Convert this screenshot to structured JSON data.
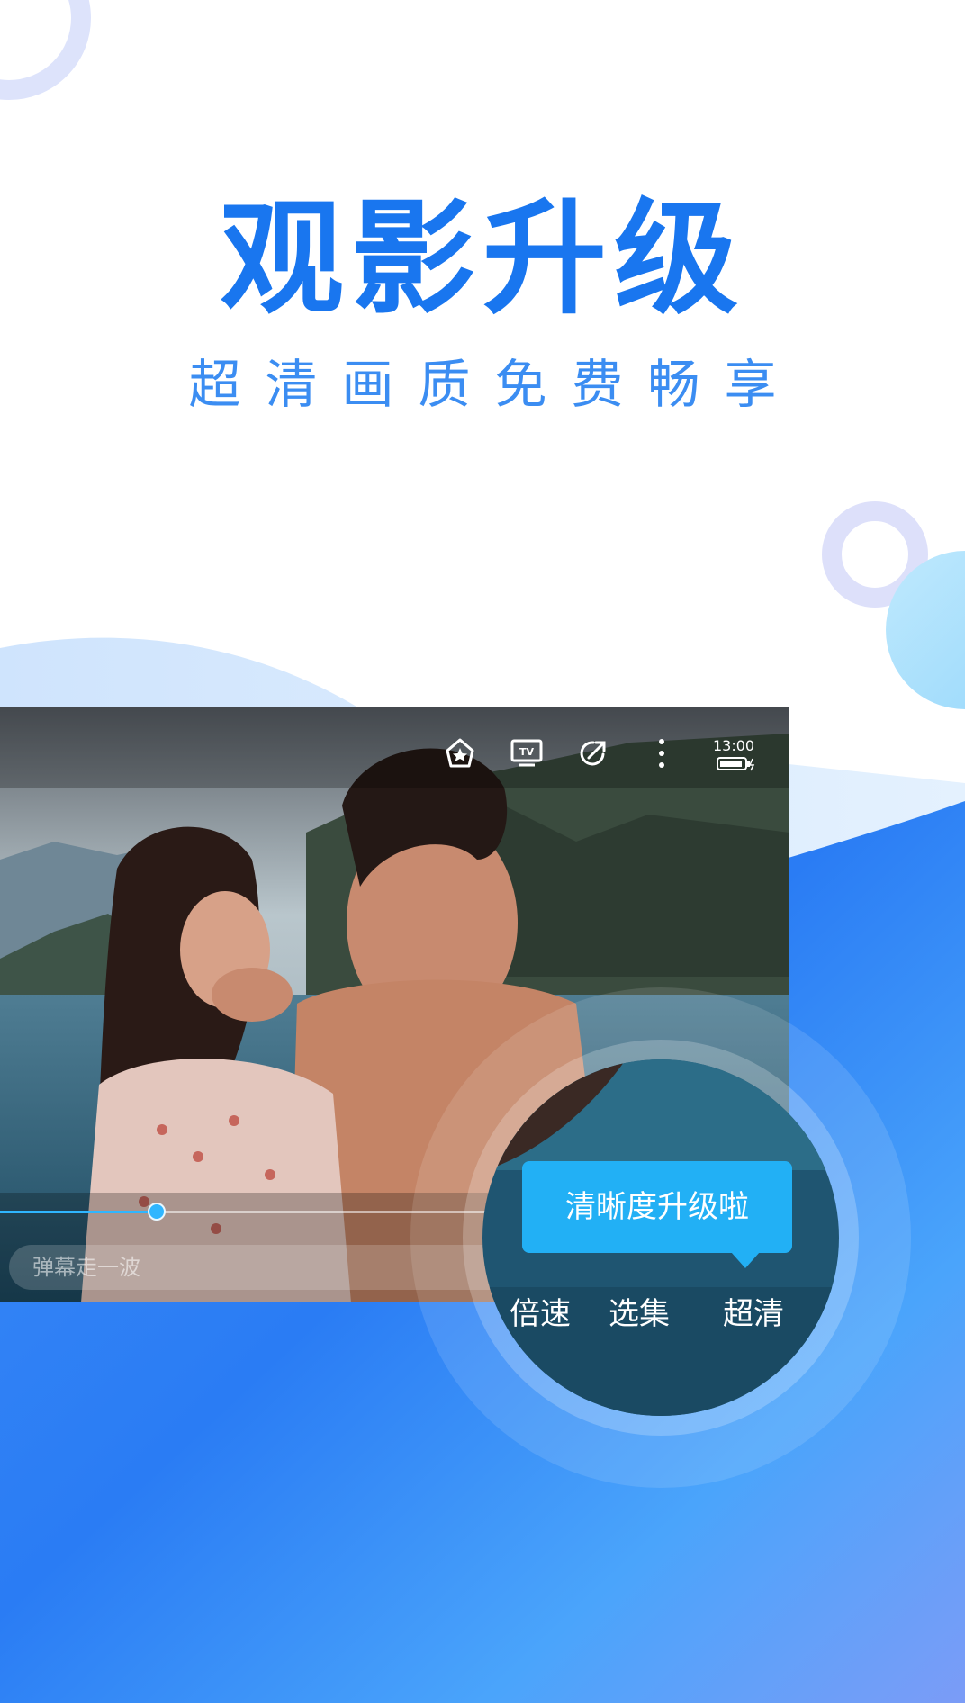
{
  "headline": "观影升级",
  "subline": "超清画质免费畅享",
  "player": {
    "status_time": "13:00",
    "progress": 0.31,
    "danmaku_placeholder": "弹幕走一波",
    "tooltip": "清晰度升级啦",
    "controls": {
      "speed_label": "倍速",
      "episodes_label": "选集",
      "quality_label": "超清"
    },
    "icons": {
      "collect": "star-house-icon",
      "tv": "tv-cast-icon",
      "share": "share-arrow-icon",
      "more": "more-vertical-icon",
      "battery": "battery-icon"
    }
  },
  "colors": {
    "accent": "#1976ef",
    "tooltip": "#22b0f5",
    "progress": "#2fb6ff"
  }
}
